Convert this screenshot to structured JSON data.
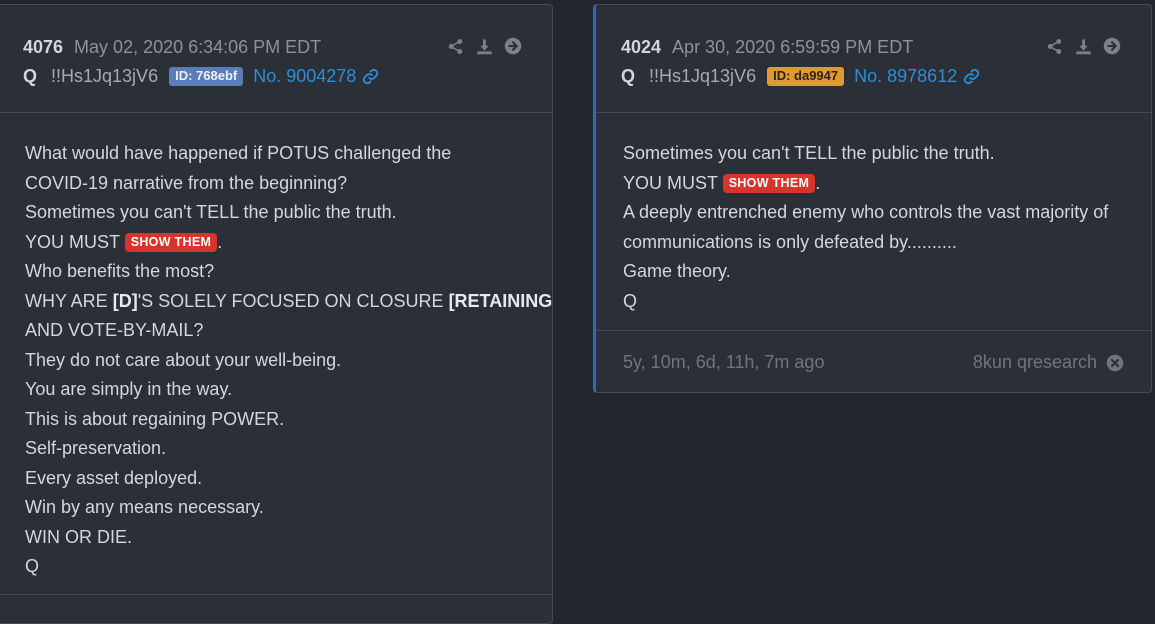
{
  "posts": [
    {
      "number": "4076",
      "date": "May 02, 2020 6:34:06 PM EDT",
      "name": "Q",
      "tripcode": "!!Hs1Jq13jV6",
      "id_label": "ID: 768ebf",
      "post_no": "No. 9004278",
      "lines": {
        "l1": "What would have happened if POTUS challenged the",
        "l2": "COVID-19 narrative from the beginning?",
        "l3": "Sometimes you can't TELL the public the truth.",
        "l4a": "YOU MUST",
        "l4tag": "SHOW THEM",
        "l4b": ".",
        "l5": "Who benefits the most?",
        "l6a": "WHY ARE ",
        "l6b": "[D]",
        "l6c": "'S SOLELY FOCUSED ON CLOSURE ",
        "l6d": "[RETAINING]",
        "l7": "AND VOTE-BY-MAIL?",
        "l8": "They do not care about your well-being.",
        "l9": "You are simply in the way.",
        "l10": "This is about regaining POWER.",
        "l11": "Self-preservation.",
        "l12": "Every asset deployed.",
        "l13": "Win by any means necessary.",
        "l14": "WIN OR DIE.",
        "l15": "Q"
      }
    },
    {
      "number": "4024",
      "date": "Apr 30, 2020 6:59:59 PM EDT",
      "name": "Q",
      "tripcode": "!!Hs1Jq13jV6",
      "id_label": "ID: da9947",
      "post_no": "No. 8978612",
      "lines": {
        "l1": "Sometimes you can't TELL the public the truth.",
        "l2a": "YOU MUST",
        "l2tag": "SHOW THEM",
        "l2b": ".",
        "l3": "A deeply entrenched enemy who controls the vast majority of",
        "l4": "communications is only defeated by..........",
        "l5": "Game theory.",
        "l6": "Q"
      },
      "footer": {
        "age": "5y, 10m, 6d, 11h, 7m ago",
        "source": "8kun qresearch"
      }
    }
  ],
  "colors": {
    "background": "#23262e",
    "card": "#2b2f38",
    "link": "#2b8ed6",
    "id_blue": "#5b7db5",
    "id_orange": "#e09a30",
    "show_them": "#d9342b",
    "selected_border": "#2a6cbb"
  },
  "icons": [
    "share-icon",
    "download-icon",
    "arrow-right-circle-icon",
    "link-icon",
    "close-circle-icon"
  ]
}
